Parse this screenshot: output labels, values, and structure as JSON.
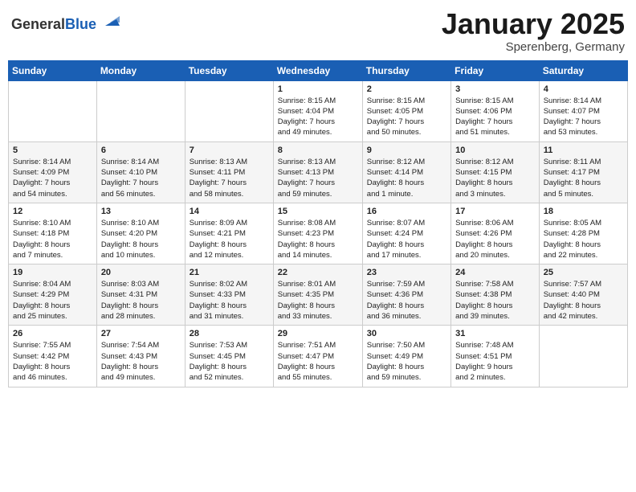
{
  "header": {
    "logo_general": "General",
    "logo_blue": "Blue",
    "month": "January 2025",
    "location": "Sperenberg, Germany"
  },
  "weekdays": [
    "Sunday",
    "Monday",
    "Tuesday",
    "Wednesday",
    "Thursday",
    "Friday",
    "Saturday"
  ],
  "weeks": [
    [
      {
        "day": "",
        "info": ""
      },
      {
        "day": "",
        "info": ""
      },
      {
        "day": "",
        "info": ""
      },
      {
        "day": "1",
        "info": "Sunrise: 8:15 AM\nSunset: 4:04 PM\nDaylight: 7 hours\nand 49 minutes."
      },
      {
        "day": "2",
        "info": "Sunrise: 8:15 AM\nSunset: 4:05 PM\nDaylight: 7 hours\nand 50 minutes."
      },
      {
        "day": "3",
        "info": "Sunrise: 8:15 AM\nSunset: 4:06 PM\nDaylight: 7 hours\nand 51 minutes."
      },
      {
        "day": "4",
        "info": "Sunrise: 8:14 AM\nSunset: 4:07 PM\nDaylight: 7 hours\nand 53 minutes."
      }
    ],
    [
      {
        "day": "5",
        "info": "Sunrise: 8:14 AM\nSunset: 4:09 PM\nDaylight: 7 hours\nand 54 minutes."
      },
      {
        "day": "6",
        "info": "Sunrise: 8:14 AM\nSunset: 4:10 PM\nDaylight: 7 hours\nand 56 minutes."
      },
      {
        "day": "7",
        "info": "Sunrise: 8:13 AM\nSunset: 4:11 PM\nDaylight: 7 hours\nand 58 minutes."
      },
      {
        "day": "8",
        "info": "Sunrise: 8:13 AM\nSunset: 4:13 PM\nDaylight: 7 hours\nand 59 minutes."
      },
      {
        "day": "9",
        "info": "Sunrise: 8:12 AM\nSunset: 4:14 PM\nDaylight: 8 hours\nand 1 minute."
      },
      {
        "day": "10",
        "info": "Sunrise: 8:12 AM\nSunset: 4:15 PM\nDaylight: 8 hours\nand 3 minutes."
      },
      {
        "day": "11",
        "info": "Sunrise: 8:11 AM\nSunset: 4:17 PM\nDaylight: 8 hours\nand 5 minutes."
      }
    ],
    [
      {
        "day": "12",
        "info": "Sunrise: 8:10 AM\nSunset: 4:18 PM\nDaylight: 8 hours\nand 7 minutes."
      },
      {
        "day": "13",
        "info": "Sunrise: 8:10 AM\nSunset: 4:20 PM\nDaylight: 8 hours\nand 10 minutes."
      },
      {
        "day": "14",
        "info": "Sunrise: 8:09 AM\nSunset: 4:21 PM\nDaylight: 8 hours\nand 12 minutes."
      },
      {
        "day": "15",
        "info": "Sunrise: 8:08 AM\nSunset: 4:23 PM\nDaylight: 8 hours\nand 14 minutes."
      },
      {
        "day": "16",
        "info": "Sunrise: 8:07 AM\nSunset: 4:24 PM\nDaylight: 8 hours\nand 17 minutes."
      },
      {
        "day": "17",
        "info": "Sunrise: 8:06 AM\nSunset: 4:26 PM\nDaylight: 8 hours\nand 20 minutes."
      },
      {
        "day": "18",
        "info": "Sunrise: 8:05 AM\nSunset: 4:28 PM\nDaylight: 8 hours\nand 22 minutes."
      }
    ],
    [
      {
        "day": "19",
        "info": "Sunrise: 8:04 AM\nSunset: 4:29 PM\nDaylight: 8 hours\nand 25 minutes."
      },
      {
        "day": "20",
        "info": "Sunrise: 8:03 AM\nSunset: 4:31 PM\nDaylight: 8 hours\nand 28 minutes."
      },
      {
        "day": "21",
        "info": "Sunrise: 8:02 AM\nSunset: 4:33 PM\nDaylight: 8 hours\nand 31 minutes."
      },
      {
        "day": "22",
        "info": "Sunrise: 8:01 AM\nSunset: 4:35 PM\nDaylight: 8 hours\nand 33 minutes."
      },
      {
        "day": "23",
        "info": "Sunrise: 7:59 AM\nSunset: 4:36 PM\nDaylight: 8 hours\nand 36 minutes."
      },
      {
        "day": "24",
        "info": "Sunrise: 7:58 AM\nSunset: 4:38 PM\nDaylight: 8 hours\nand 39 minutes."
      },
      {
        "day": "25",
        "info": "Sunrise: 7:57 AM\nSunset: 4:40 PM\nDaylight: 8 hours\nand 42 minutes."
      }
    ],
    [
      {
        "day": "26",
        "info": "Sunrise: 7:55 AM\nSunset: 4:42 PM\nDaylight: 8 hours\nand 46 minutes."
      },
      {
        "day": "27",
        "info": "Sunrise: 7:54 AM\nSunset: 4:43 PM\nDaylight: 8 hours\nand 49 minutes."
      },
      {
        "day": "28",
        "info": "Sunrise: 7:53 AM\nSunset: 4:45 PM\nDaylight: 8 hours\nand 52 minutes."
      },
      {
        "day": "29",
        "info": "Sunrise: 7:51 AM\nSunset: 4:47 PM\nDaylight: 8 hours\nand 55 minutes."
      },
      {
        "day": "30",
        "info": "Sunrise: 7:50 AM\nSunset: 4:49 PM\nDaylight: 8 hours\nand 59 minutes."
      },
      {
        "day": "31",
        "info": "Sunrise: 7:48 AM\nSunset: 4:51 PM\nDaylight: 9 hours\nand 2 minutes."
      },
      {
        "day": "",
        "info": ""
      }
    ]
  ]
}
